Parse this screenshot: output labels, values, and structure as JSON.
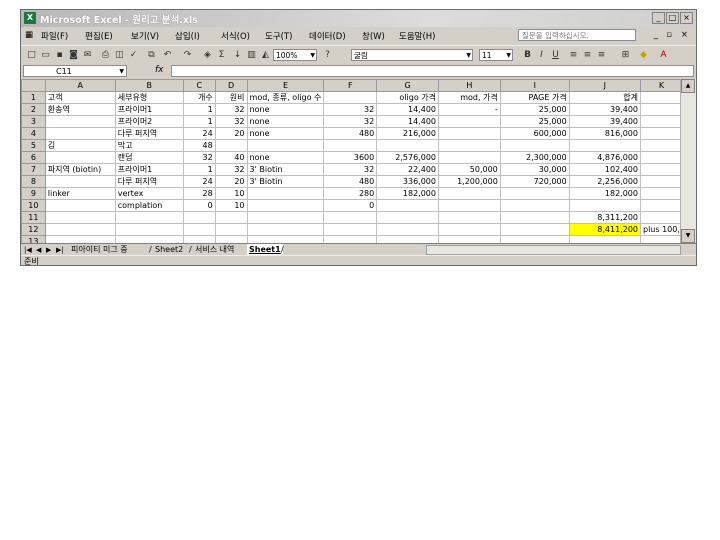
{
  "window": {
    "app_name": "Microsoft Excel",
    "file_name": "원리고 분석.xls",
    "min_glyph": "_",
    "max_glyph": "□",
    "close_glyph": "×"
  },
  "menu": {
    "items": [
      "파일(F)",
      "편집(E)",
      "보기(V)",
      "삽입(I)",
      "서식(O)",
      "도구(T)",
      "데이터(D)",
      "창(W)",
      "도움말(H)"
    ],
    "ask_placeholder": "질문을 입력하십시오."
  },
  "toolbar": {
    "zoom": "100%",
    "font_name": "굴림",
    "font_size": "11"
  },
  "formula_bar": {
    "name_box": "C11",
    "fx_label": "fx",
    "formula": ""
  },
  "grid": {
    "columns": [
      "A",
      "B",
      "C",
      "D",
      "E",
      "F",
      "G",
      "H",
      "I",
      "J",
      "K"
    ],
    "rows": [
      {
        "n": "1",
        "cells": [
          "고객",
          "세부유형",
          "개수",
          "원비",
          "mod, 종류, oligo 수",
          "",
          "oligo 가격",
          "mod, 가격",
          "PAGE 가격",
          "합계",
          ""
        ]
      },
      {
        "n": "2",
        "cells": [
          "환송역",
          "프라이머1",
          "1",
          "32",
          "none",
          "32",
          "14,400",
          "-",
          "25,000",
          "39,400",
          ""
        ]
      },
      {
        "n": "3",
        "cells": [
          "",
          "프라이머2",
          "1",
          "32",
          "none",
          "32",
          "14,400",
          "",
          "25,000",
          "39,400",
          ""
        ]
      },
      {
        "n": "4",
        "cells": [
          "",
          "다루 퍼지역",
          "24",
          "20",
          "none",
          "480",
          "216,000",
          "",
          "600,000",
          "816,000",
          ""
        ]
      },
      {
        "n": "5",
        "cells": [
          "김",
          "막고",
          "48",
          "",
          "",
          "",
          "",
          "",
          "",
          "",
          ""
        ]
      },
      {
        "n": "6",
        "cells": [
          "",
          "랜덤",
          "32",
          "40",
          "none",
          "3600",
          "2,576,000",
          "",
          "2,300,000",
          "4,876,000",
          ""
        ]
      },
      {
        "n": "7",
        "cells": [
          "파지역 (biotin)",
          "프라이머1",
          "1",
          "32",
          "3' Biotin",
          "32",
          "22,400",
          "50,000",
          "30,000",
          "102,400",
          ""
        ]
      },
      {
        "n": "8",
        "cells": [
          "",
          "다루 퍼지역",
          "24",
          "20",
          "3' Biotin",
          "480",
          "336,000",
          "1,200,000",
          "720,000",
          "2,256,000",
          ""
        ]
      },
      {
        "n": "9",
        "cells": [
          "linker",
          "vertex",
          "28",
          "10",
          "",
          "280",
          "182,000",
          "",
          "",
          "182,000",
          ""
        ]
      },
      {
        "n": "10",
        "cells": [
          "",
          "complation",
          "0",
          "10",
          "",
          "0",
          "",
          "",
          "",
          "",
          ""
        ]
      },
      {
        "n": "11",
        "cells": [
          "",
          "",
          "",
          "",
          "",
          "",
          "",
          "",
          "",
          "8,311,200",
          ""
        ]
      },
      {
        "n": "12",
        "cells": [
          "",
          "",
          "",
          "",
          "",
          "",
          "",
          "",
          "",
          "8,411,200",
          "plus 100,"
        ]
      },
      {
        "n": "13",
        "cells": [
          "",
          "",
          "",
          "",
          "",
          "",
          "",
          "",
          "",
          "",
          ""
        ]
      }
    ]
  },
  "sheet_tabs": [
    "피아이티 미그 중",
    "Sheet2",
    "서비스 내역",
    "Sheet1"
  ],
  "active_tab_index": 3,
  "status_text": "준비",
  "colors": {
    "highlight": "#ffff00",
    "chrome": "#d4d0c8"
  }
}
